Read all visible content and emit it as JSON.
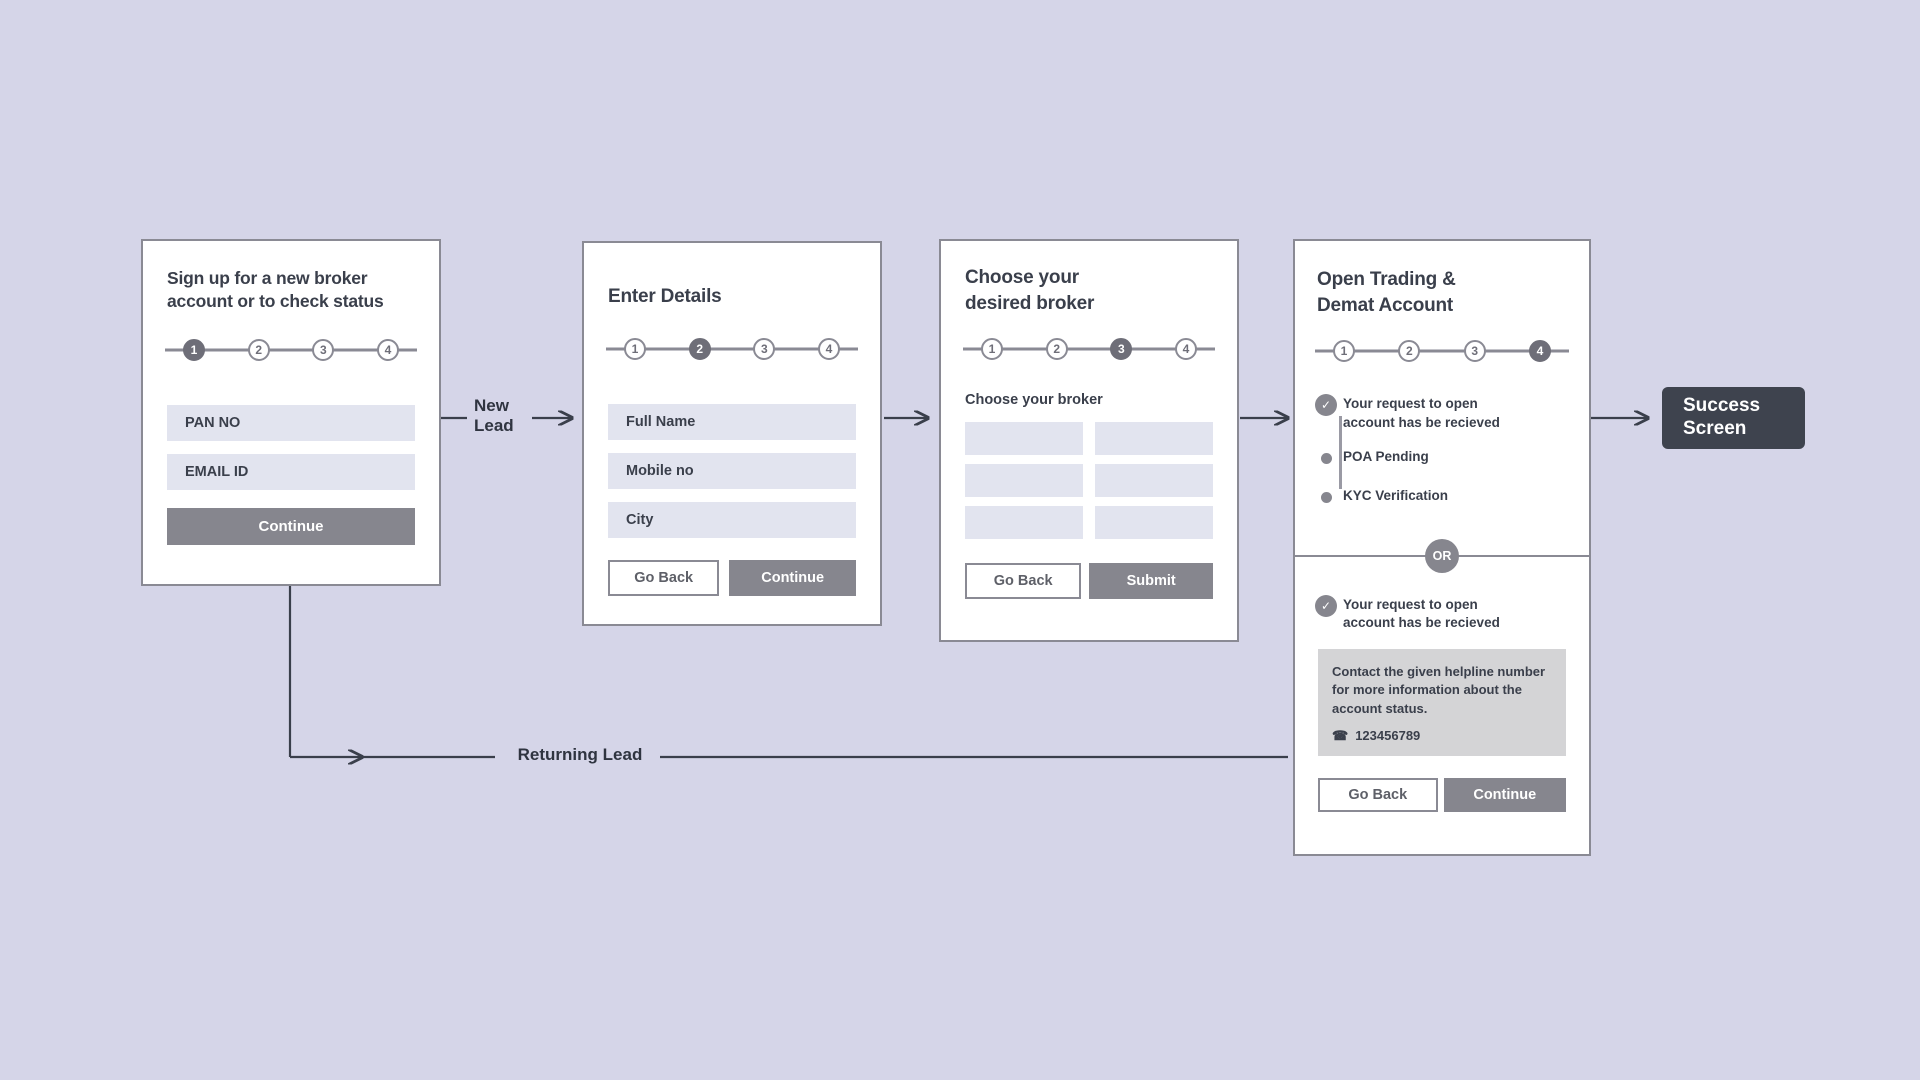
{
  "meta": {
    "background_color": "#d5d5e8",
    "accent_gray": "#86868e",
    "text_dark": "#3a3f4b",
    "field_fill": "#e2e4ef",
    "success_fill": "#3e434e"
  },
  "flow_labels": {
    "new_lead": "New\nLead",
    "new_lead_line1": "New",
    "new_lead_line2": "Lead",
    "returning_lead": "Returning Lead"
  },
  "cards": {
    "signup": {
      "title": "Sign up for a new broker account or to check status",
      "stepper": {
        "steps": [
          "1",
          "2",
          "3",
          "4"
        ],
        "active_index": 0
      },
      "fields": [
        {
          "name": "pan-no-field",
          "label": "PAN NO"
        },
        {
          "name": "email-id-field",
          "label": "EMAIL ID"
        }
      ],
      "primary_button": "Continue"
    },
    "details": {
      "title": "Enter Details",
      "stepper": {
        "steps": [
          "1",
          "2",
          "3",
          "4"
        ],
        "active_index": 1
      },
      "fields": [
        {
          "name": "full-name-field",
          "label": "Full Name"
        },
        {
          "name": "mobile-no-field",
          "label": "Mobile no"
        },
        {
          "name": "city-field",
          "label": "City"
        }
      ],
      "back_button": "Go Back",
      "primary_button": "Continue"
    },
    "broker": {
      "title_line1": "Choose your",
      "title_line2": "desired broker",
      "stepper": {
        "steps": [
          "1",
          "2",
          "3",
          "4"
        ],
        "active_index": 2
      },
      "section_label": "Choose your broker",
      "tiles_count": 6,
      "back_button": "Go Back",
      "primary_button": "Submit"
    },
    "account": {
      "title_line1": "Open Trading &",
      "title_line2": "Demat Account",
      "stepper": {
        "steps": [
          "1",
          "2",
          "3",
          "4"
        ],
        "active_index": 3
      },
      "status_items": [
        {
          "text_line1": "Your request to open",
          "text_line2": "account has be recieved",
          "state": "done"
        },
        {
          "text_line1": "POA Pending",
          "text_line2": "",
          "state": "pending"
        },
        {
          "text_line1": "KYC Verification",
          "text_line2": "",
          "state": "pending"
        }
      ],
      "divider_label": "OR",
      "alt_status": {
        "text_line1": "Your request to open",
        "text_line2": "account has be recieved",
        "state": "done"
      },
      "helpline": {
        "text": "Contact the given helpline number for more information about the account status.",
        "phone": "123456789",
        "phone_icon": "phone-icon"
      },
      "back_button": "Go Back",
      "primary_button": "Continue"
    },
    "success": {
      "title_line1": "Success",
      "title_line2": "Screen"
    }
  }
}
